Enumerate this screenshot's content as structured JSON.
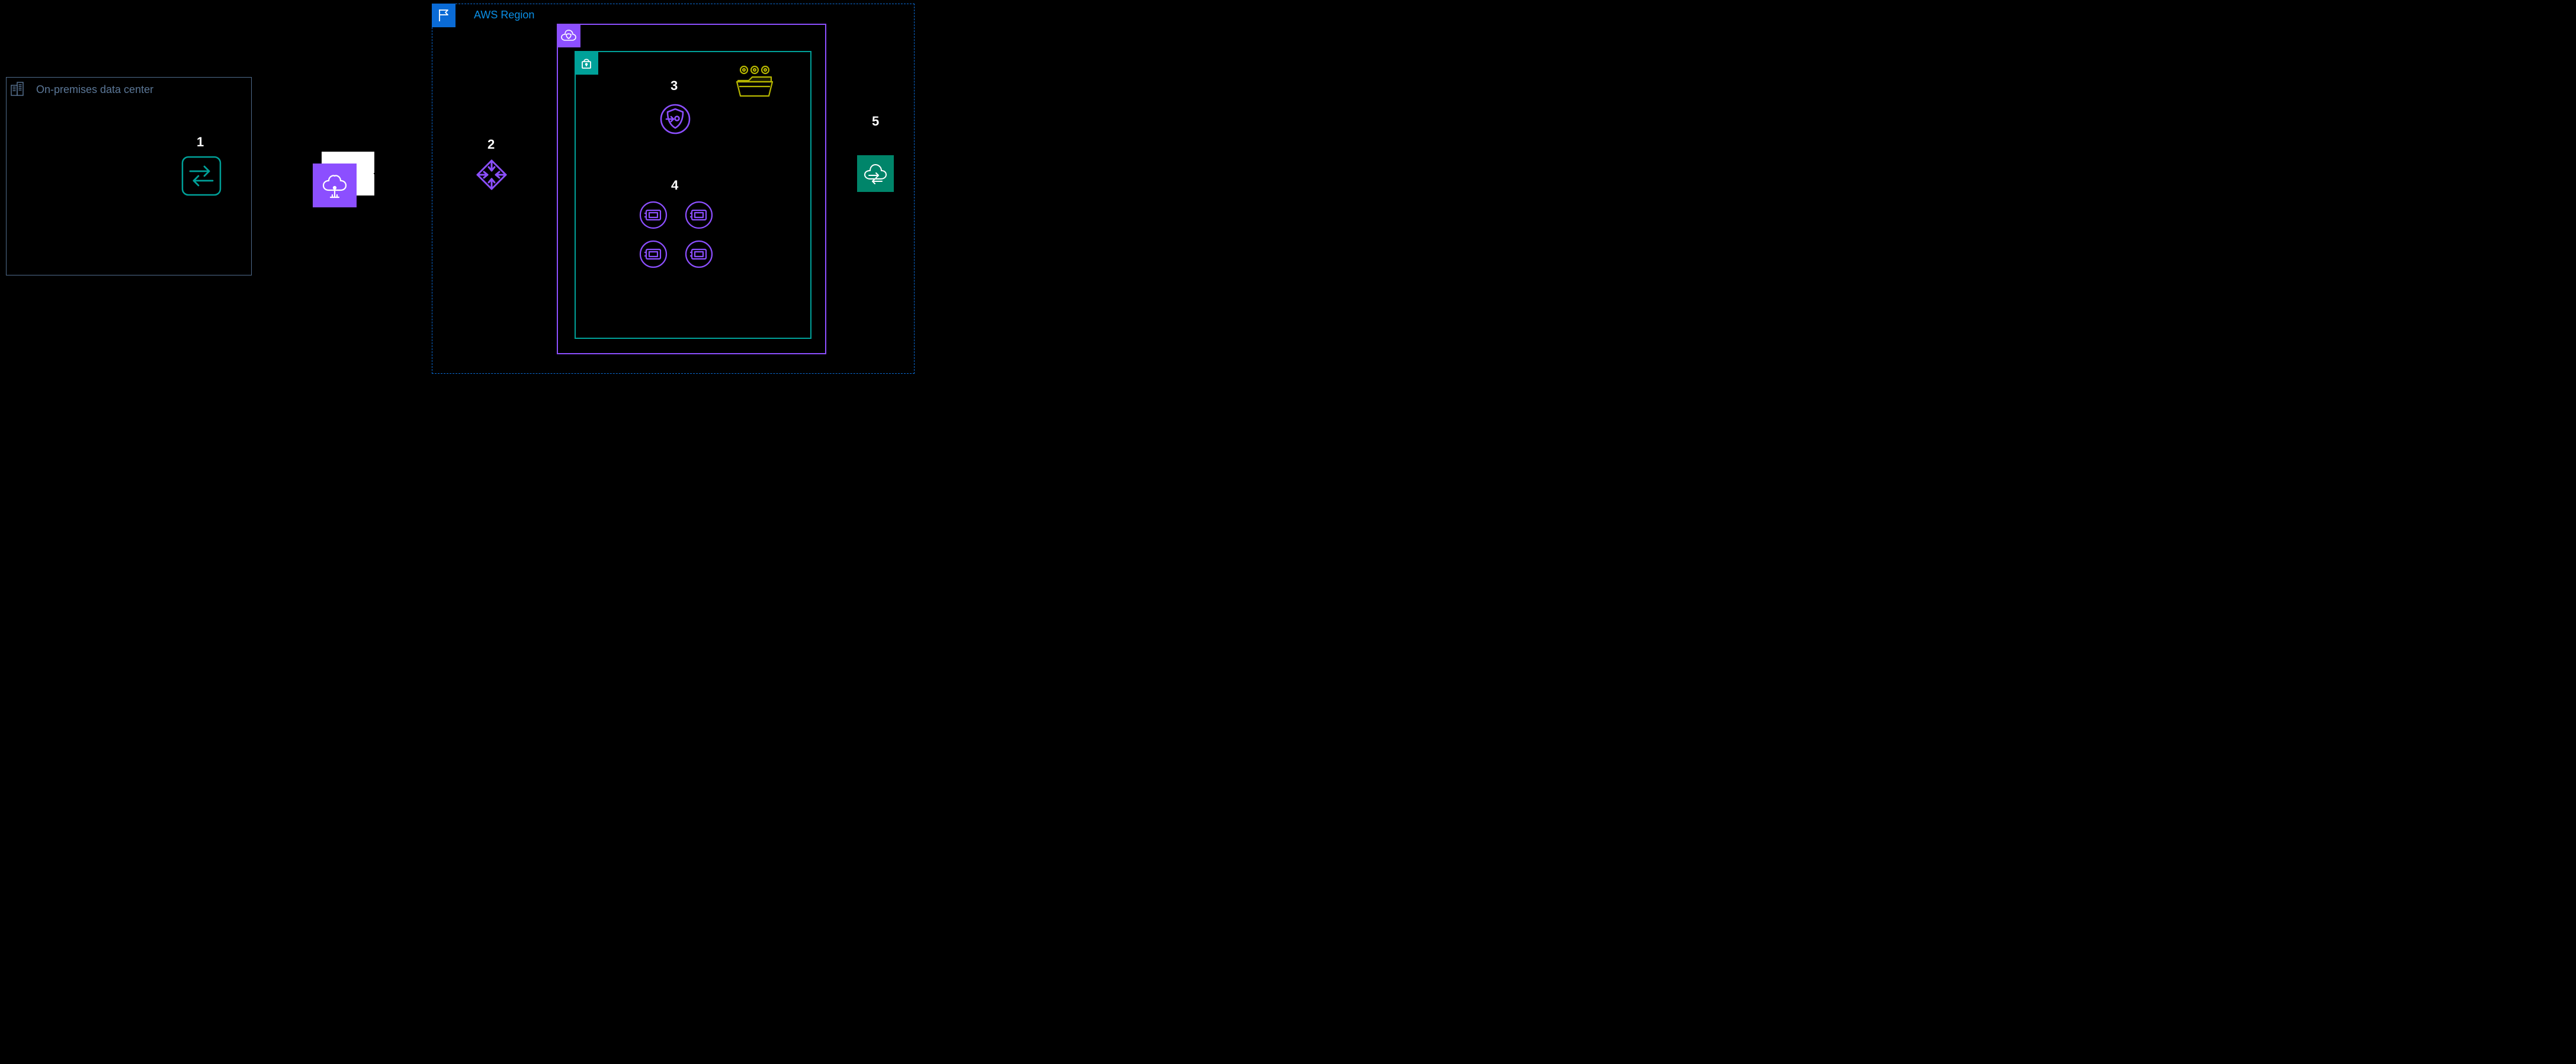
{
  "onprem": {
    "title": "On-premises data center"
  },
  "region": {
    "title": "AWS Region"
  },
  "marks": {
    "m1": "1",
    "m2": "2",
    "m3": "3",
    "m4": "4",
    "m5": "5"
  }
}
